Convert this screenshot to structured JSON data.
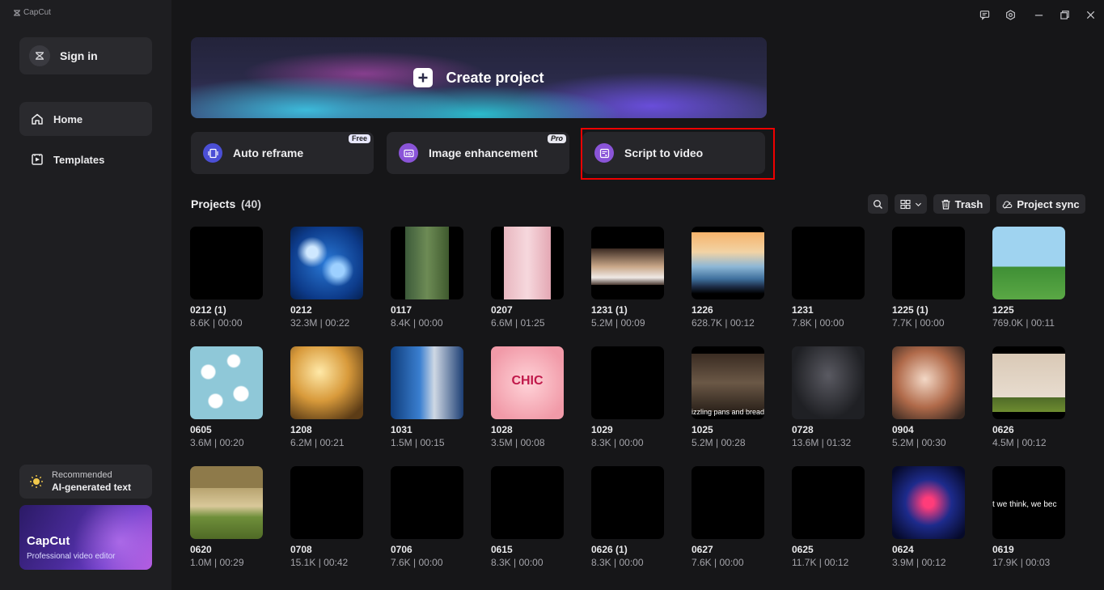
{
  "app": {
    "brand": "CapCut"
  },
  "sidebar": {
    "signin_label": "Sign in",
    "nav": [
      {
        "label": "Home",
        "icon": "home-icon"
      },
      {
        "label": "Templates",
        "icon": "templates-icon"
      }
    ],
    "recommended": {
      "label": "Recommended",
      "title": "AI-generated text"
    },
    "promo": {
      "title": "CapCut",
      "subtitle": "Professional video editor"
    }
  },
  "main": {
    "create_label": "Create project",
    "features": [
      {
        "label": "Auto reframe",
        "badge": "Free"
      },
      {
        "label": "Image enhancement",
        "badge": "Pro"
      },
      {
        "label": "Script to video",
        "badge": ""
      }
    ],
    "projects_title": "Projects",
    "projects_count": "(40)",
    "trash_label": "Trash",
    "sync_label": "Project sync"
  },
  "projects": [
    {
      "name": "0212 (1)",
      "meta": "8.6K | 00:00",
      "thumb": "black"
    },
    {
      "name": "0212",
      "meta": "32.3M | 00:22",
      "thumb": "blue-bokeh"
    },
    {
      "name": "0117",
      "meta": "8.4K | 00:00",
      "thumb": "woman-phone"
    },
    {
      "name": "0207",
      "meta": "6.6M | 01:25",
      "thumb": "woman-pink"
    },
    {
      "name": "1231 (1)",
      "meta": "5.2M | 00:09",
      "thumb": "wedding"
    },
    {
      "name": "1226",
      "meta": "628.7K | 00:12",
      "thumb": "mountains"
    },
    {
      "name": "1231",
      "meta": "7.8K | 00:00",
      "thumb": "black"
    },
    {
      "name": "1225 (1)",
      "meta": "7.7K | 00:00",
      "thumb": "black"
    },
    {
      "name": "1225",
      "meta": "769.0K | 00:11",
      "thumb": "anime-field"
    },
    {
      "name": "0605",
      "meta": "3.6M | 00:20",
      "thumb": "clouds"
    },
    {
      "name": "1208",
      "meta": "6.2M | 00:21",
      "thumb": "golden"
    },
    {
      "name": "1031",
      "meta": "1.5M | 00:15",
      "thumb": "news"
    },
    {
      "name": "1028",
      "meta": "3.5M | 00:08",
      "thumb": "pink-logo",
      "caption": "CHIC"
    },
    {
      "name": "1029",
      "meta": "8.3K | 00:00",
      "thumb": "black"
    },
    {
      "name": "1025",
      "meta": "5.2M | 00:28",
      "thumb": "restaurant",
      "caption": "izzling pans and bread"
    },
    {
      "name": "0728",
      "meta": "13.6M | 01:32",
      "thumb": "woman-leather"
    },
    {
      "name": "0904",
      "meta": "5.2M | 00:30",
      "thumb": "family"
    },
    {
      "name": "0626",
      "meta": "4.5M | 00:12",
      "thumb": "robin"
    },
    {
      "name": "0620",
      "meta": "1.0M | 00:29",
      "thumb": "dog"
    },
    {
      "name": "0708",
      "meta": "15.1K | 00:42",
      "thumb": "black"
    },
    {
      "name": "0706",
      "meta": "7.6K | 00:00",
      "thumb": "black"
    },
    {
      "name": "0615",
      "meta": "8.3K | 00:00",
      "thumb": "black"
    },
    {
      "name": "0626 (1)",
      "meta": "8.3K | 00:00",
      "thumb": "black"
    },
    {
      "name": "0627",
      "meta": "7.6K | 00:00",
      "thumb": "black"
    },
    {
      "name": "0625",
      "meta": "11.7K | 00:12",
      "thumb": "black"
    },
    {
      "name": "0624",
      "meta": "3.9M | 00:12",
      "thumb": "neon-figure"
    },
    {
      "name": "0619",
      "meta": "17.9K | 00:03",
      "thumb": "text",
      "caption": "t we think, we bec"
    }
  ]
}
